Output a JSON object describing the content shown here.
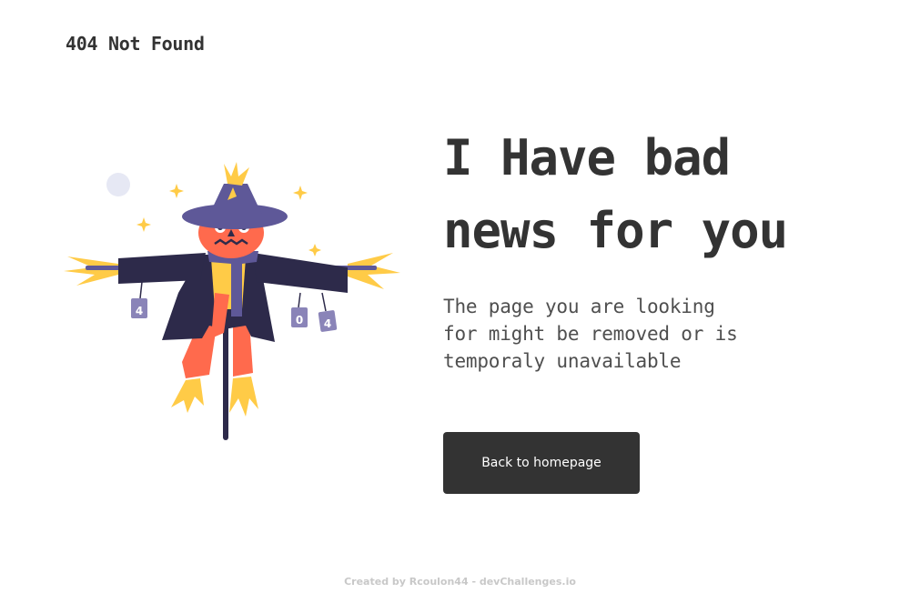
{
  "header": {
    "logo_text": "404 Not Found"
  },
  "hero": {
    "headline_line1": "I Have bad",
    "headline_line2": "news for you",
    "subtext_line1": "The page you are looking",
    "subtext_line2": "for might be removed or is",
    "subtext_line3": "temporaly unavailable",
    "button_label": "Back to homepage"
  },
  "illustration": {
    "subject": "scarecrow",
    "can_labels": [
      "4",
      "0",
      "4"
    ]
  },
  "footer": {
    "credit": "Created by Rcoulon44 - devChallenges.io"
  },
  "colors": {
    "text": "#333333",
    "subtext": "#4f4f4f",
    "button_bg": "#333333",
    "button_text": "#ffffff",
    "footer_text": "#c8c8c8",
    "coat": "#2d2a4a",
    "hat": "#5e5898",
    "pumpkin": "#ff6a4d",
    "straw": "#ffcb47"
  }
}
